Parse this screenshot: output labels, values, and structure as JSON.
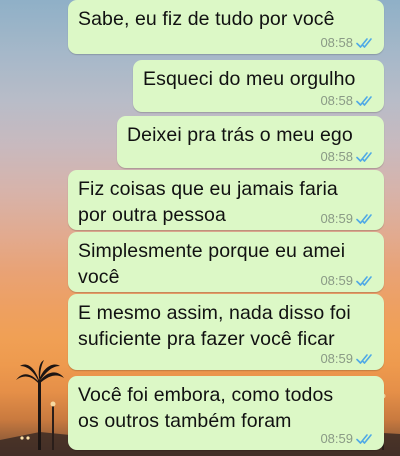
{
  "chat": {
    "messages": [
      {
        "text": "Sabe, eu fiz de tudo por você",
        "time": "08:58",
        "status": "read"
      },
      {
        "text": "Esqueci do meu orgulho",
        "time": "08:58",
        "status": "read"
      },
      {
        "text": "Deixei pra trás o meu ego",
        "time": "08:58",
        "status": "read"
      },
      {
        "text": "Fiz coisas que eu jamais faria\npor outra pessoa",
        "time": "08:59",
        "status": "read"
      },
      {
        "text": "Simplesmente porque eu amei\nvocê",
        "time": "08:59",
        "status": "read"
      },
      {
        "text": "E mesmo assim, nada disso foi\nsuficiente pra fazer você ficar",
        "time": "08:59",
        "status": "read"
      },
      {
        "text": "Você foi embora, como todos\nos outros também foram",
        "time": "08:59",
        "status": "read"
      }
    ]
  },
  "colors": {
    "bubble": "#dcf8c6",
    "read_ticks": "#4fa9e6",
    "time_text": "#8a9a86"
  },
  "icons": {
    "read_receipt": "double-check-icon"
  }
}
